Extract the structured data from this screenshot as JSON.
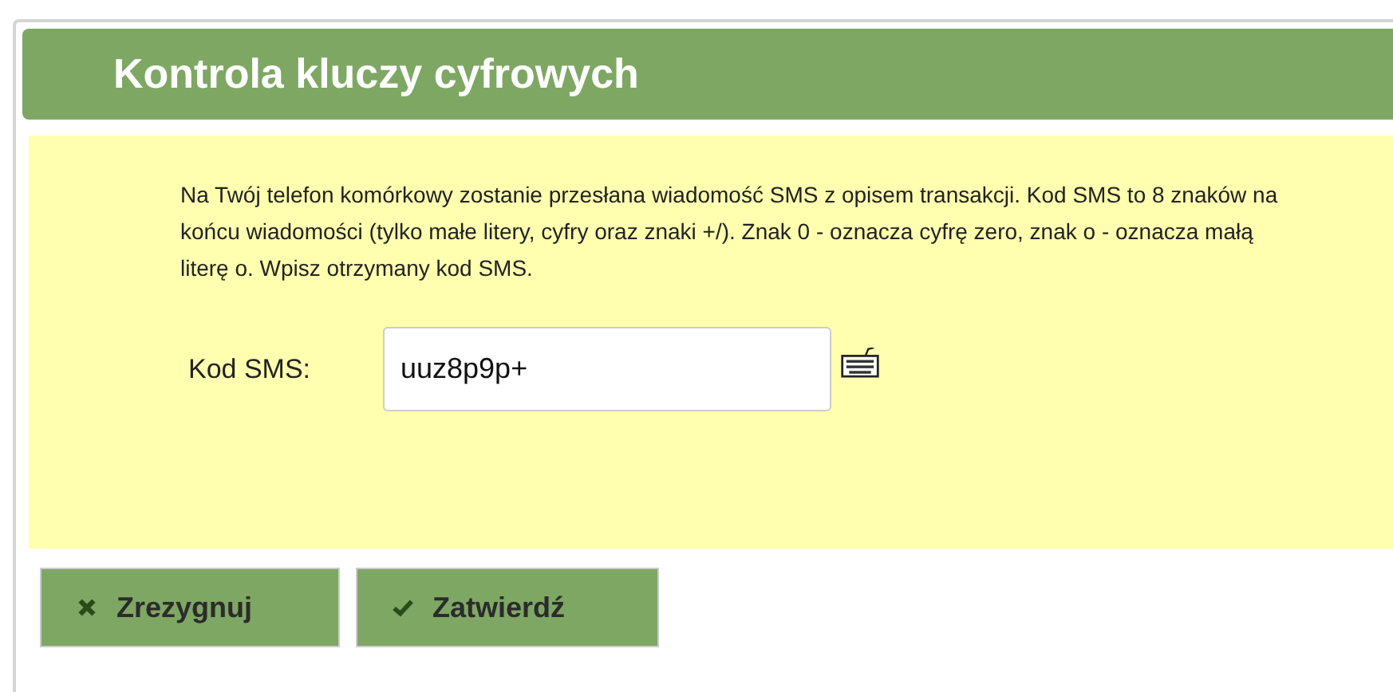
{
  "panel": {
    "title": "Kontrola kluczy cyfrowych"
  },
  "message": "Na Twój telefon komórkowy zostanie przesłana wiadomość SMS z opisem transakcji. Kod SMS to 8 znaków na końcu wiadomości (tylko małe litery, cyfry oraz znaki +/). Znak 0 - oznacza cyfrę zero, znak o - oznacza małą literę o. Wpisz otrzymany kod SMS.",
  "sms_field": {
    "label": "Kod SMS:",
    "value": "uuz8p9p+"
  },
  "buttons": [
    {
      "label": "Zrezygnuj",
      "kind": "cancel"
    },
    {
      "label": "Zatwierdź",
      "kind": "confirm"
    }
  ]
}
